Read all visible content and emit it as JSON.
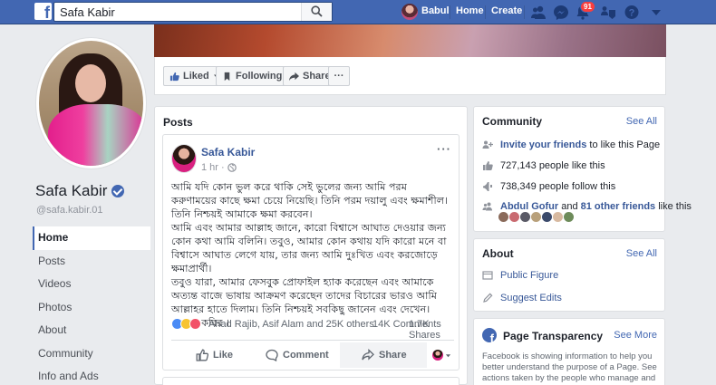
{
  "topbar": {
    "search_value": "Safa Kabir",
    "user_name": "Babul",
    "home_label": "Home",
    "create_label": "Create",
    "notifications_count": "91"
  },
  "page_actions": {
    "liked_label": "Liked",
    "following_label": "Following",
    "share_label": "Share",
    "more_label": "···"
  },
  "profile": {
    "name": "Safa Kabir",
    "handle": "@safa.kabir.01"
  },
  "left_nav": {
    "items": [
      "Home",
      "Posts",
      "Videos",
      "Photos",
      "About",
      "Community",
      "Info and Ads"
    ],
    "active": "Home"
  },
  "posts_section": {
    "title": "Posts"
  },
  "post": {
    "author": "Safa Kabir",
    "time": "1 hr",
    "more": "···",
    "paragraphs": [
      "আমি যদি কোন ভুল করে থাকি সেই ভুলের জন্য আমি পরম করুণাময়ের কাছে ক্ষমা চেয়ে নিয়েছি। তিনি পরম দয়ালু এবং ক্ষমাশীল। তিনি নিশ্চয়ই আমাকে ক্ষমা করবেন।",
      "আমি এবং আমার আল্লাহ জানে, কারো বিশ্বাসে আঘাত দেওয়ার জন্য কোন কথা আমি বলিনি। তবুও, আমার কোন কথায় যদি কারো মনে বা বিশ্বাসে আঘাত লেগে যায়, তার জন্য আমি দুঃখিত এবং করজোড়ে ক্ষমাপ্রার্থী।",
      "তবুও যারা, আমার ফেসবুক প্রোফাইল হ্যাক করেছেন এবং আমাকে অত্যন্ত বাজে ভাষায় আক্রমণ করেছেন তাদের বিচারের ভারও আমি আল্লাহর হাতে দিলাম। তিনি নিশ্চয়ই সবকিছু জানেন এবং দেখেন।",
      "- সাফা কবির ।"
    ],
    "reactions_text": "Ahad Rajib, Asif Alam and 25K others",
    "comments_count": "14K Comments",
    "shares_count": "1.7K Shares",
    "like_label": "Like",
    "comment_label": "Comment",
    "share_label": "Share"
  },
  "community": {
    "title": "Community",
    "see_all": "See All",
    "invite_link": "Invite your friends",
    "invite_rest": "to like this Page",
    "likes": "727,143 people like this",
    "follows": "738,349 people follow this",
    "friend_name": "Abdul Gofur",
    "friend_and": "and",
    "friends_link": "81 other friends",
    "friends_rest": "like this"
  },
  "about": {
    "title": "About",
    "see_all": "See All",
    "public_figure": "Public Figure",
    "suggest_edits": "Suggest Edits"
  },
  "transparency": {
    "title": "Page Transparency",
    "see_more": "See More",
    "text": "Facebook is showing information to help you better understand the purpose of a Page. See actions taken by the people who manage and post content."
  },
  "colors": {
    "brand_blue": "#4267b2",
    "link_blue": "#385898",
    "notification_red": "#fa3e3e"
  },
  "icons": [
    "facebook-logo-icon",
    "search-icon",
    "friends-icon",
    "messenger-icon",
    "notifications-icon",
    "groups-icon",
    "help-icon",
    "dropdown-arrow-icon",
    "verified-icon",
    "globe-icon",
    "like-icon",
    "comment-icon",
    "share-icon"
  ]
}
